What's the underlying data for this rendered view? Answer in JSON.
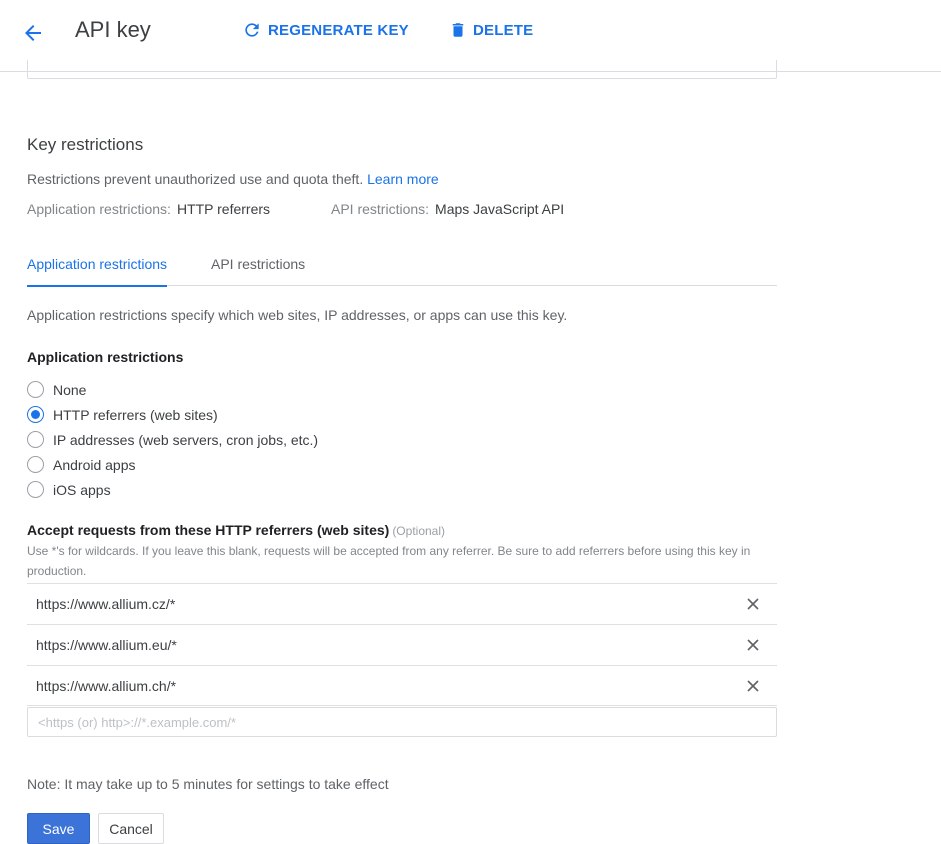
{
  "header": {
    "title": "API key",
    "regenerate_label": "REGENERATE KEY",
    "delete_label": "DELETE"
  },
  "restrictions": {
    "title": "Key restrictions",
    "description": "Restrictions prevent unauthorized use and quota theft.",
    "learn_more": "Learn more",
    "app_label": "Application restrictions:",
    "app_value": "HTTP referrers",
    "api_label": "API restrictions:",
    "api_value": "Maps JavaScript API"
  },
  "tabs": [
    {
      "label": "Application restrictions",
      "active": true
    },
    {
      "label": "API restrictions",
      "active": false
    }
  ],
  "tab_description": "Application restrictions specify which web sites, IP addresses, or apps can use this key.",
  "app_restrictions": {
    "title": "Application restrictions",
    "options": [
      {
        "label": "None",
        "checked": false
      },
      {
        "label": "HTTP referrers (web sites)",
        "checked": true
      },
      {
        "label": "IP addresses (web servers, cron jobs, etc.)",
        "checked": false
      },
      {
        "label": "Android apps",
        "checked": false
      },
      {
        "label": "iOS apps",
        "checked": false
      }
    ]
  },
  "referrers": {
    "title": "Accept requests from these HTTP referrers (web sites)",
    "optional": "(Optional)",
    "help": "Use *'s for wildcards. If you leave this blank, requests will be accepted from any referrer. Be sure to add referrers before using this key in production.",
    "items": [
      "https://www.allium.cz/*",
      "https://www.allium.eu/*",
      "https://www.allium.ch/*"
    ],
    "new_placeholder": "<https (or) http>://*.example.com/*"
  },
  "note": "Note: It may take up to 5 minutes for settings to take effect",
  "footer": {
    "save_label": "Save",
    "cancel_label": "Cancel"
  },
  "colors": {
    "accent": "#1a73e8",
    "save_button": "#3b73d9"
  },
  "icons": {
    "back": "arrow-back-icon",
    "regenerate": "refresh-icon",
    "delete": "trash-icon",
    "remove": "close-icon"
  }
}
